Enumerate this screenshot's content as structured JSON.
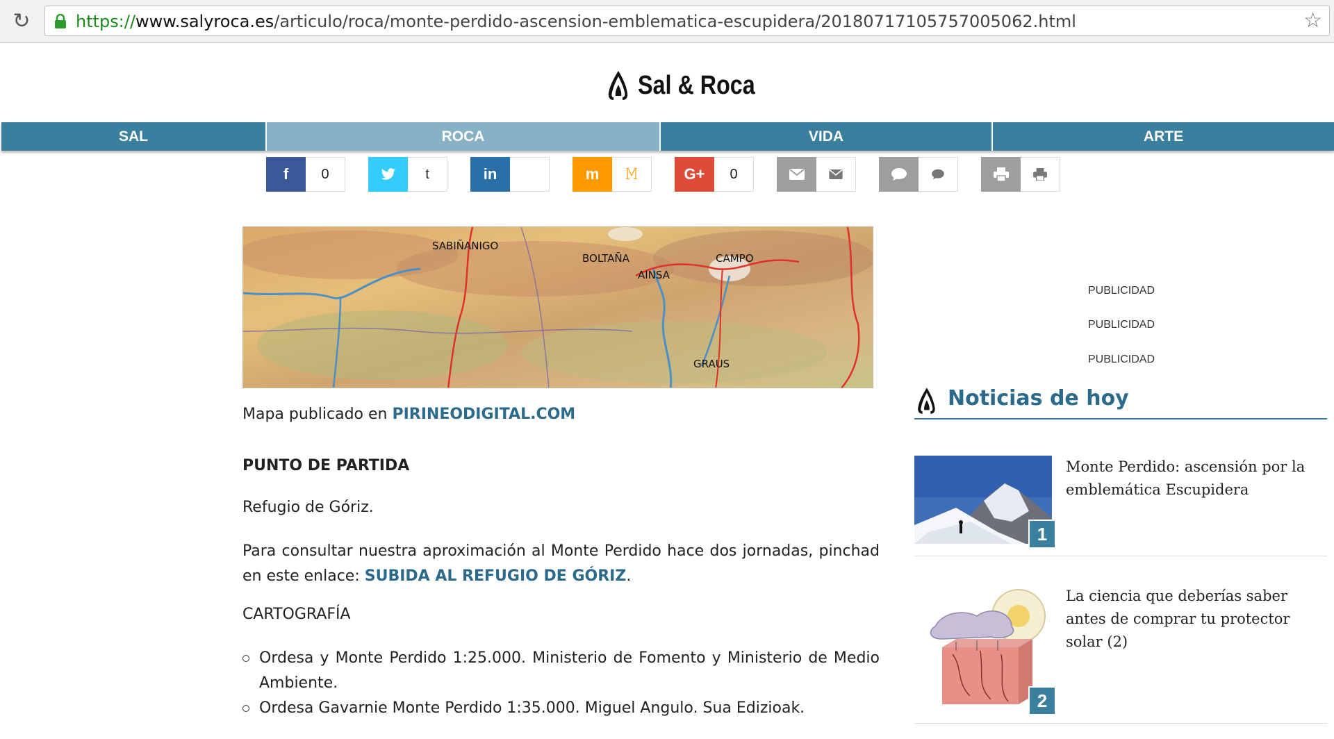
{
  "browser": {
    "url_scheme": "https://",
    "url_host": "www.salyroca.es",
    "url_path": "/articulo/roca/monte-perdido-ascension-emblematica-escupidera/20180717105757005062.html"
  },
  "site": {
    "logo_text": "Sal & Roca"
  },
  "nav": {
    "items": [
      {
        "label": "SAL"
      },
      {
        "label": "ROCA"
      },
      {
        "label": "VIDA"
      },
      {
        "label": "ARTE"
      }
    ],
    "active": "ROCA"
  },
  "share": [
    {
      "network": "facebook",
      "icon": "f",
      "count": "0",
      "color": "#3b5998"
    },
    {
      "network": "twitter",
      "icon": "t",
      "count": "t",
      "color": "#33ccff"
    },
    {
      "network": "linkedin",
      "icon": "in",
      "count": "",
      "color": "#2a6fa6"
    },
    {
      "network": "meneame",
      "icon": "m",
      "count": "",
      "color": "#ff9900"
    },
    {
      "network": "google-plus",
      "icon": "G+",
      "count": "0",
      "color": "#dd4b39"
    },
    {
      "network": "email",
      "icon": "email",
      "count": "",
      "color": "#9e9e9e"
    },
    {
      "network": "comments",
      "icon": "comment",
      "count": "",
      "color": "#9e9e9e"
    },
    {
      "network": "print",
      "icon": "print",
      "count": "",
      "color": "#9e9e9e"
    }
  ],
  "map": {
    "labels": [
      "SABIÑANIGO",
      "BOLTAÑA",
      "AINSA",
      "CAMPO",
      "GRAUS"
    ]
  },
  "article": {
    "caption_prefix": "Mapa publicado en ",
    "caption_link": "PIRINEODIGITAL.COM",
    "heading": "PUNTO DE PARTIDA",
    "p1": "Refugio de Góriz.",
    "p2_prefix": "Para consultar nuestra aproximación al Monte Perdido hace dos jornadas, pinchad en este enlace: ",
    "p2_link": "SUBIDA AL REFUGIO DE GÓRIZ",
    "p2_suffix": ".",
    "p3": "CARTOGRAFÍA",
    "list": [
      "Ordesa y Monte Perdido 1:25.000. Ministerio de Fomento y Ministerio de Medio Ambiente.",
      "Ordesa Gavarnie Monte Perdido 1:35.000. Miguel Angulo. Sua Edizioak."
    ]
  },
  "sidebar": {
    "ads": [
      "PUBLICIDAD",
      "PUBLICIDAD",
      "PUBLICIDAD"
    ],
    "news_title": "Noticias de hoy",
    "news": [
      {
        "number": "1",
        "title": "Monte Perdido: ascensión por la emblemática Escupidera"
      },
      {
        "number": "2",
        "title": "La ciencia que deberías saber antes de comprar tu protector solar (2)"
      }
    ]
  },
  "colors": {
    "brand": "#3a7f9e",
    "nav_active": "#87b2c6",
    "link": "#2c6a8c"
  }
}
